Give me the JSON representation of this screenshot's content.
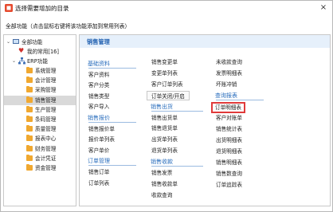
{
  "window": {
    "title": "选择需要增加的目录",
    "close_glyph": "×"
  },
  "prompt": "全部功能（点击鼠标右键将该功能添加到常用列表）",
  "tree": {
    "root": "全部功能",
    "favorites": "我的常用[16]",
    "erp": "ERP功能",
    "modules": [
      "系统管理",
      "会计管理",
      "采购管理",
      "销售管理",
      "生产管理",
      "条码管理",
      "质量管理",
      "报表中心",
      "财务管理",
      "会计凭证",
      "资金管理"
    ],
    "selected": "销售管理"
  },
  "content": {
    "header": "销售管理",
    "col1": [
      {
        "kind": "section",
        "text": "基础资料"
      },
      {
        "kind": "item",
        "text": "客户资料"
      },
      {
        "kind": "item",
        "text": "客户分类"
      },
      {
        "kind": "item",
        "text": "销售类型"
      },
      {
        "kind": "item",
        "text": "客户导入"
      },
      {
        "kind": "section",
        "text": "销售报价"
      },
      {
        "kind": "item",
        "text": "销售报价单"
      },
      {
        "kind": "item",
        "text": "报价单列表"
      },
      {
        "kind": "item",
        "text": "客户单价"
      },
      {
        "kind": "section",
        "text": "订单管理"
      },
      {
        "kind": "item",
        "text": "销售订单"
      },
      {
        "kind": "item",
        "text": "订单列表"
      }
    ],
    "col2": [
      {
        "kind": "item",
        "text": "销售变更单"
      },
      {
        "kind": "item",
        "text": "变更单列表"
      },
      {
        "kind": "item",
        "text": "客户订单列表"
      },
      {
        "kind": "boxed",
        "text": "订单关闭/开启"
      },
      {
        "kind": "section",
        "text": "销售出货"
      },
      {
        "kind": "item",
        "text": "销售出货单"
      },
      {
        "kind": "item",
        "text": "销售退货单"
      },
      {
        "kind": "item",
        "text": "出货单列表"
      },
      {
        "kind": "item",
        "text": "退货单列表"
      },
      {
        "kind": "section",
        "text": "销售收款"
      },
      {
        "kind": "item",
        "text": "销售发票"
      },
      {
        "kind": "item",
        "text": "销售收款单"
      },
      {
        "kind": "item",
        "text": "收款查询"
      }
    ],
    "col3": [
      {
        "kind": "item",
        "text": "未收款查询"
      },
      {
        "kind": "item",
        "text": "发票明细表"
      },
      {
        "kind": "item",
        "text": "坏账冲销"
      },
      {
        "kind": "section",
        "text": "查询报表"
      },
      {
        "kind": "highlight",
        "text": "订单明细表"
      },
      {
        "kind": "item",
        "text": "客户对账单"
      },
      {
        "kind": "item",
        "text": "销售统计表"
      },
      {
        "kind": "item",
        "text": "出货明细表"
      },
      {
        "kind": "item",
        "text": "退货明细表"
      },
      {
        "kind": "item",
        "text": "销售明细表"
      },
      {
        "kind": "item",
        "text": "销售数查询"
      },
      {
        "kind": "item",
        "text": "订单追踪表"
      }
    ]
  }
}
